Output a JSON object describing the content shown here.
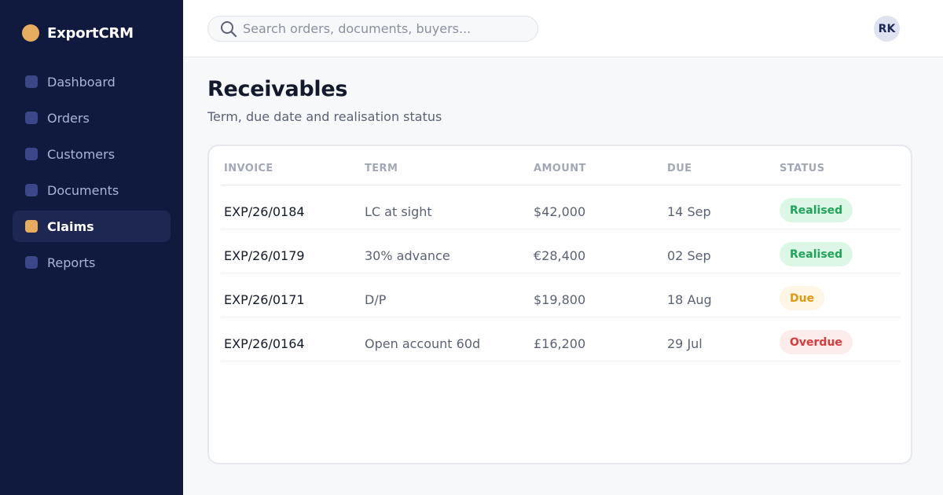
{
  "app": {
    "name": "ExportCRM"
  },
  "sidebar": {
    "items": [
      {
        "label": "Dashboard",
        "active": false
      },
      {
        "label": "Orders",
        "active": false
      },
      {
        "label": "Customers",
        "active": false
      },
      {
        "label": "Documents",
        "active": false
      },
      {
        "label": "Claims",
        "active": true
      },
      {
        "label": "Reports",
        "active": false
      }
    ]
  },
  "header": {
    "search_placeholder": "Search orders, documents, buyers...",
    "search_value": "",
    "user_initials": "RK"
  },
  "page": {
    "title": "Receivables",
    "subtitle": "Term, due date and realisation status"
  },
  "table": {
    "columns": [
      "INVOICE",
      "TERM",
      "AMOUNT",
      "DUE",
      "STATUS"
    ],
    "rows": [
      {
        "invoice": "EXP/26/0184",
        "term": "LC at sight",
        "amount": "$42,000",
        "due": "14 Sep",
        "status": "Realised"
      },
      {
        "invoice": "EXP/26/0179",
        "term": "30% advance",
        "amount": "€28,400",
        "due": "02 Sep",
        "status": "Realised"
      },
      {
        "invoice": "EXP/26/0171",
        "term": "D/P",
        "amount": "$19,800",
        "due": "18 Aug",
        "status": "Due"
      },
      {
        "invoice": "EXP/26/0164",
        "term": "Open account 60d",
        "amount": "£16,200",
        "due": "29 Jul",
        "status": "Overdue"
      }
    ]
  },
  "colors": {
    "sidebar_bg": "#101a3f",
    "accent": "#e8ac5e",
    "status_realised": "#22a35a",
    "status_due": "#e09a12",
    "status_overdue": "#d83b3b"
  },
  "icons": {
    "brand": "brand-logo-icon",
    "search": "search-icon",
    "nav": "nav-square-icon"
  }
}
